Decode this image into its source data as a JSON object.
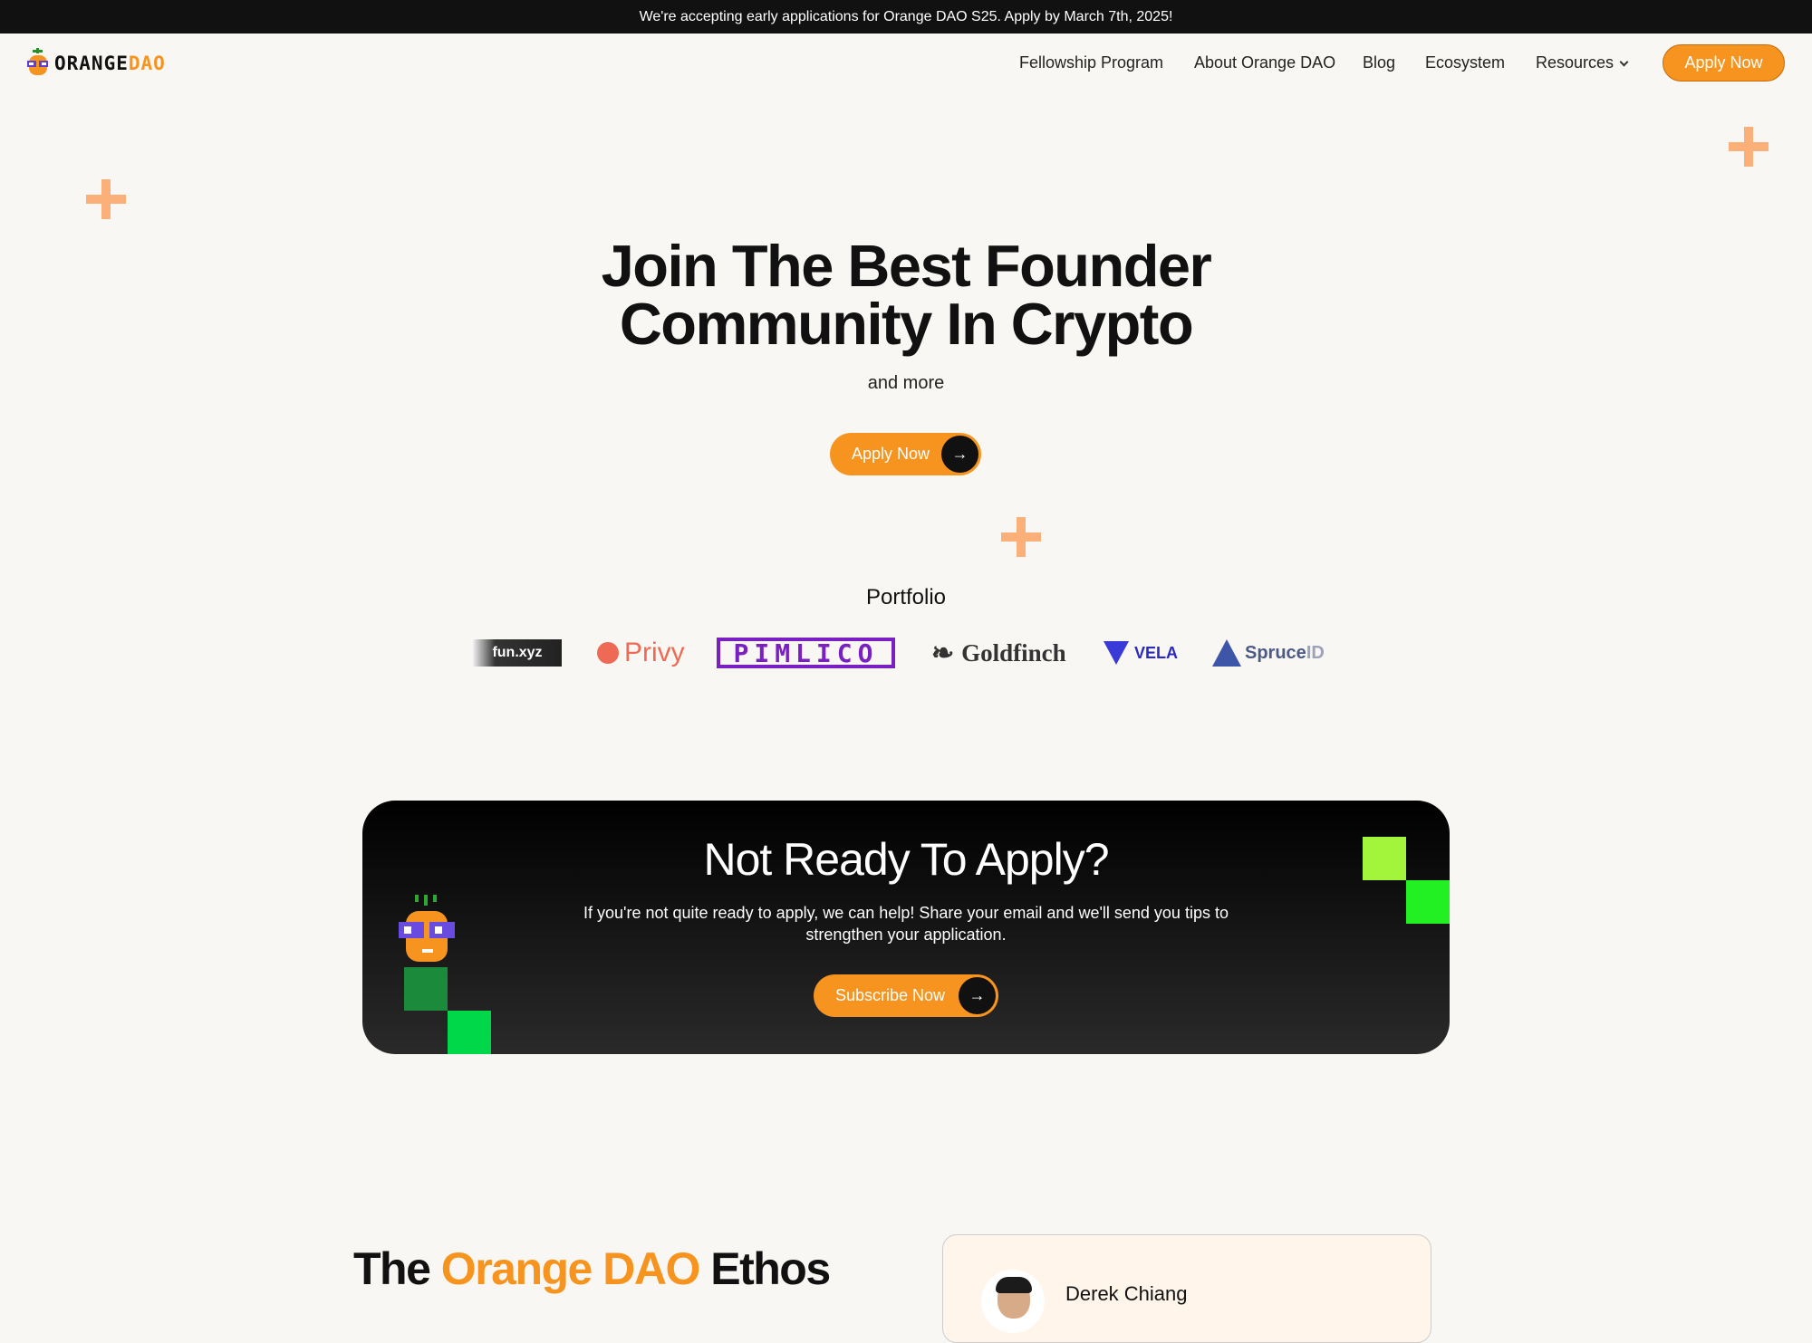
{
  "announcement": "We're accepting early applications for Orange DAO S25.  Apply by March 7th, 2025!",
  "brand": {
    "logo_part1": "ORANGE",
    "logo_part2": "DAO",
    "accent_color": "#f7941f"
  },
  "nav": {
    "items": [
      "Fellowship Program",
      "About Orange DAO",
      "Blog",
      "Ecosystem",
      "Resources"
    ],
    "apply_label": "Apply Now"
  },
  "hero": {
    "title_line1": "Join The Best Founder",
    "title_line2": "Community In Crypto",
    "subtitle": "and more",
    "apply_label": "Apply Now"
  },
  "portfolio": {
    "title": "Portfolio",
    "logos": [
      "fun.xyz",
      "Privy",
      "PIMLICO",
      "Goldfinch",
      "VELA",
      "Spruce",
      "ID"
    ]
  },
  "cta": {
    "title": "Not Ready To Apply?",
    "text": "If you're not quite ready to apply, we can help! Share your email and we'll send you tips to strengthen your application.",
    "button_label": "Subscribe Now"
  },
  "ethos": {
    "title_prefix": "The ",
    "title_accent": "Orange DAO",
    "title_suffix": " Ethos"
  },
  "testimonial": {
    "name": "Derek Chiang"
  },
  "icons": {
    "arrow": "→",
    "dropdown": "chevron-down-icon"
  }
}
